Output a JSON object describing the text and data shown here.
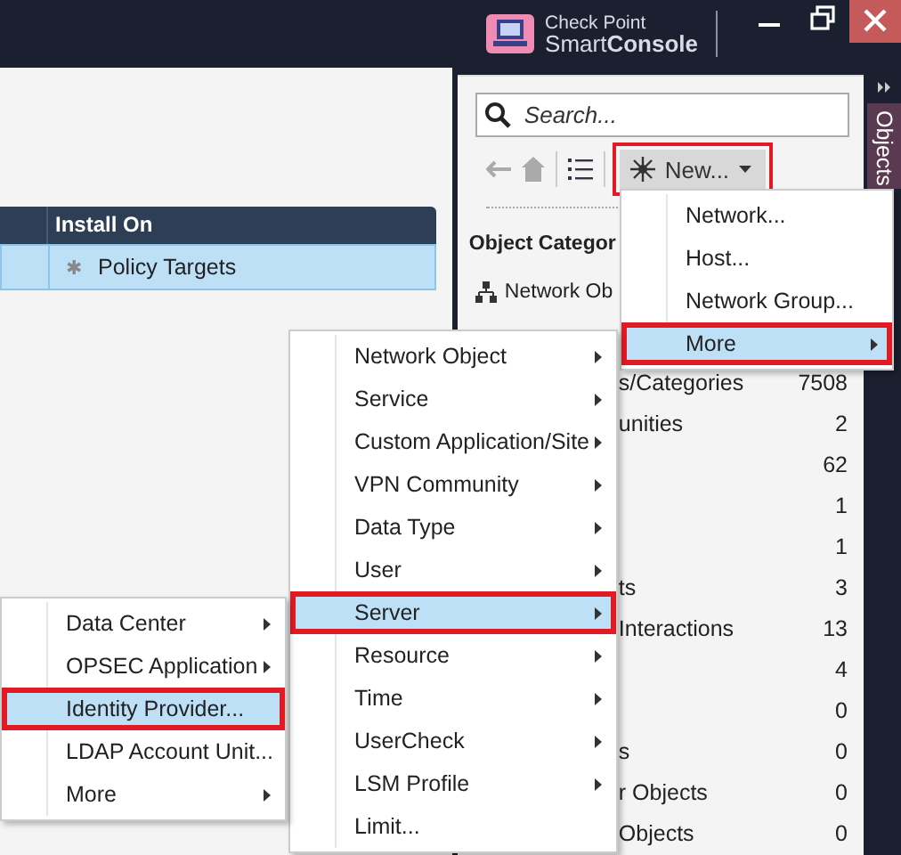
{
  "title_bar": {
    "brand_top": "Check Point",
    "brand_bottom": "Smart**Console**"
  },
  "rule_table": {
    "columns": [
      "Install On"
    ],
    "rows": [
      {
        "icon": "✱",
        "install_on": "Policy Targets",
        "selected": true
      }
    ]
  },
  "objects_panel": {
    "tab": "Objects",
    "search": {
      "placeholder": "Search..."
    },
    "new_button": {
      "label": "New...",
      "annotated": true
    },
    "heading": "Object Categor",
    "categories": [
      {
        "label": "Network Ob"
      },
      {
        "label": "s/Categories",
        "count": "7508"
      },
      {
        "label": "unities",
        "count": "2"
      },
      {
        "count": "62"
      },
      {
        "count": "1"
      },
      {
        "count": "1"
      },
      {
        "label": "ts",
        "count": "3"
      },
      {
        "label": "Interactions",
        "count": "13"
      },
      {
        "count": "4"
      },
      {
        "count": "0"
      },
      {
        "label": "s",
        "count": "0"
      },
      {
        "label": "r Objects",
        "count": "0"
      },
      {
        "label": "Objects",
        "count": "0"
      }
    ]
  },
  "menus": [
    {
      "items": [
        {
          "label": "Network...",
          "submenu": false,
          "selected": false,
          "annotated": false
        },
        {
          "label": "Host...",
          "submenu": false,
          "selected": false,
          "annotated": false
        },
        {
          "label": "Network Group...",
          "submenu": false,
          "selected": false,
          "annotated": false
        },
        {
          "label": "More",
          "submenu": true,
          "selected": true,
          "annotated": true
        }
      ]
    },
    {
      "items": [
        {
          "label": "Network Object",
          "submenu": true,
          "selected": false,
          "annotated": false
        },
        {
          "label": "Service",
          "submenu": true,
          "selected": false,
          "annotated": false
        },
        {
          "label": "Custom Application/Site",
          "submenu": true,
          "selected": false,
          "annotated": false
        },
        {
          "label": "VPN Community",
          "submenu": true,
          "selected": false,
          "annotated": false
        },
        {
          "label": "Data Type",
          "submenu": true,
          "selected": false,
          "annotated": false
        },
        {
          "label": "User",
          "submenu": true,
          "selected": false,
          "annotated": false
        },
        {
          "label": "Server",
          "submenu": true,
          "selected": true,
          "annotated": true
        },
        {
          "label": "Resource",
          "submenu": true,
          "selected": false,
          "annotated": false
        },
        {
          "label": "Time",
          "submenu": true,
          "selected": false,
          "annotated": false
        },
        {
          "label": "UserCheck",
          "submenu": true,
          "selected": false,
          "annotated": false
        },
        {
          "label": "LSM Profile",
          "submenu": true,
          "selected": false,
          "annotated": false
        },
        {
          "label": "Limit...",
          "submenu": false,
          "selected": false,
          "annotated": false
        }
      ]
    },
    {
      "items": [
        {
          "label": "Data Center",
          "submenu": true,
          "selected": false,
          "annotated": false
        },
        {
          "label": "OPSEC Application",
          "submenu": true,
          "selected": false,
          "annotated": false
        },
        {
          "label": "Identity Provider...",
          "submenu": false,
          "selected": true,
          "annotated": true
        },
        {
          "label": "LDAP Account Unit...",
          "submenu": false,
          "selected": false,
          "annotated": false
        },
        {
          "label": "More",
          "submenu": true,
          "selected": false,
          "annotated": false
        }
      ]
    }
  ]
}
